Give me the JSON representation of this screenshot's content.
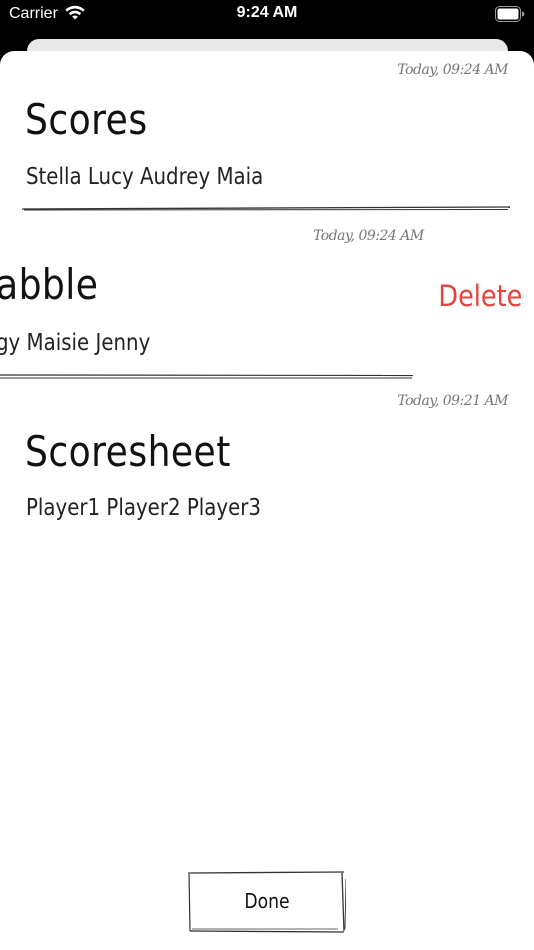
{
  "status_bar": {
    "carrier": "Carrier",
    "time": "9:24 AM"
  },
  "notes": [
    {
      "date": "Today, 09:24 AM",
      "title": "Scores",
      "body": "Stella Lucy Audrey Maia"
    },
    {
      "date": "Today, 09:24 AM",
      "title": "abble",
      "body": "gy Maisie Jenny",
      "swiped": true
    },
    {
      "date": "Today, 09:21 AM",
      "title": "Scoresheet",
      "body": "Player1 Player2 Player3"
    }
  ],
  "actions": {
    "delete_label": "Delete",
    "done_label": "Done"
  },
  "colors": {
    "delete": "#e8403a",
    "text": "#111111",
    "date": "#777777"
  }
}
